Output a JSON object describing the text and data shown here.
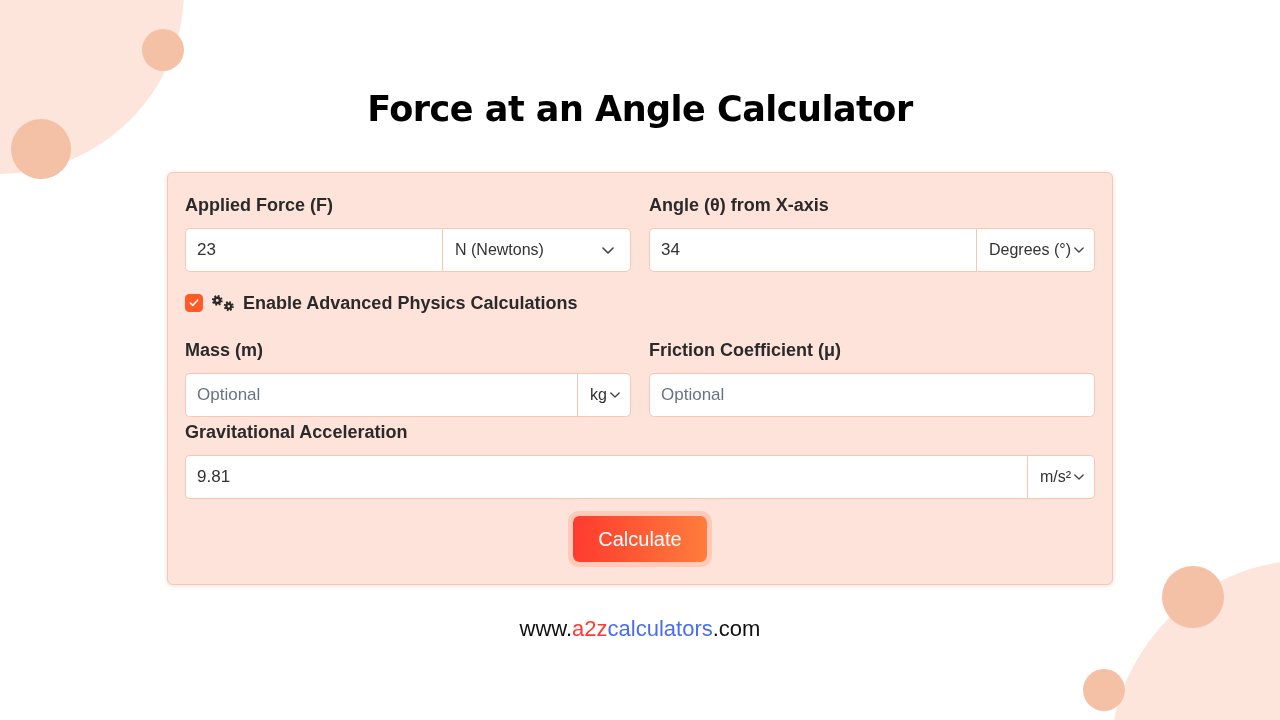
{
  "title": "Force at an Angle Calculator",
  "force": {
    "label": "Applied Force (F)",
    "value": "23",
    "unit": "N (Newtons)"
  },
  "angle": {
    "label": "Angle (θ) from X-axis",
    "value": "34",
    "unit": "Degrees (°)"
  },
  "advanced_toggle": {
    "label": "Enable Advanced Physics Calculations",
    "checked": true
  },
  "mass": {
    "label": "Mass (m)",
    "placeholder": "Optional",
    "unit": "kg"
  },
  "friction": {
    "label": "Friction Coefficient (μ)",
    "placeholder": "Optional"
  },
  "gravity": {
    "label": "Gravitational Acceleration",
    "value": "9.81",
    "unit": "m/s²"
  },
  "calculate_button": "Calculate",
  "footer": {
    "segments": [
      {
        "text": "www.",
        "kind": "plain"
      },
      {
        "text": "a2z",
        "kind": "accent"
      },
      {
        "text": "calculators",
        "kind": "link"
      },
      {
        "text": ".com",
        "kind": "plain"
      }
    ]
  }
}
